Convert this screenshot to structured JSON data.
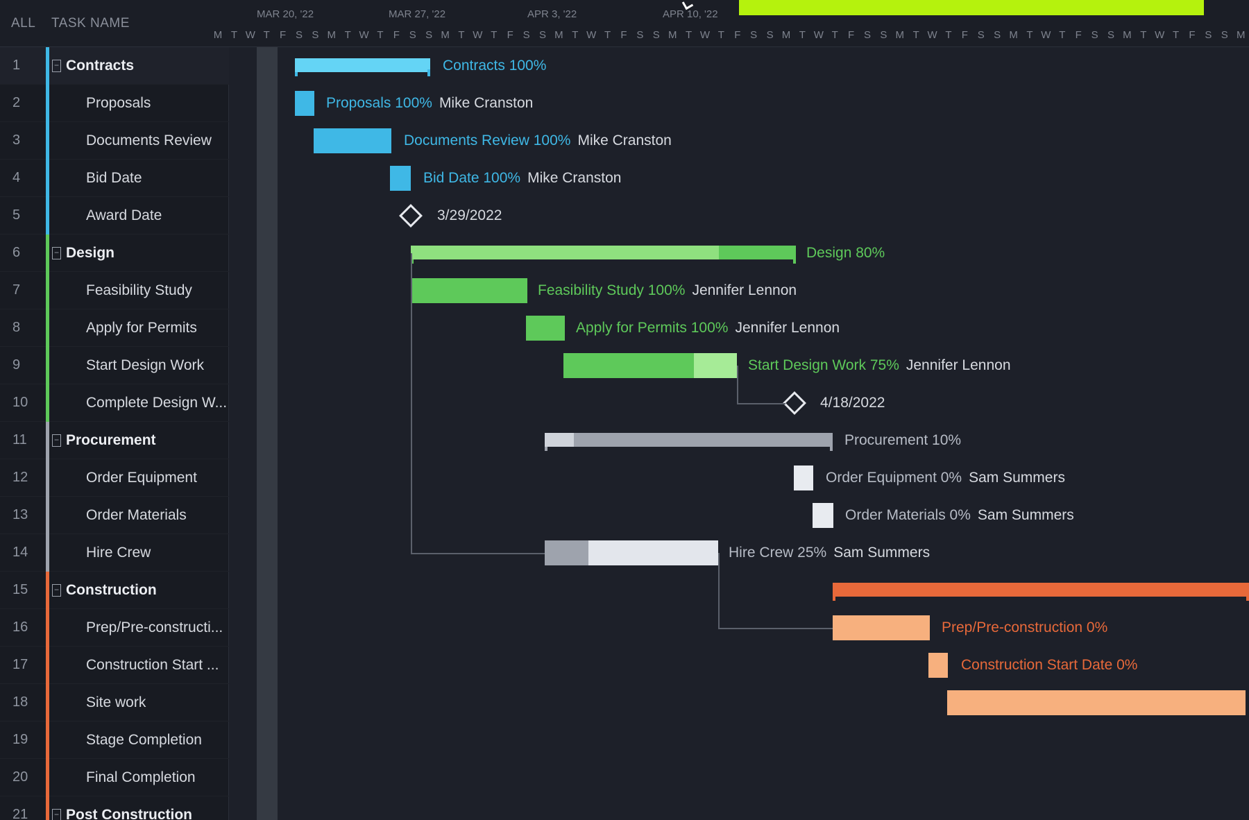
{
  "grid": {
    "header": {
      "all_label": "ALL",
      "name_label": "TASK NAME"
    },
    "rows": [
      {
        "num": "1",
        "name": "Contracts",
        "group": true,
        "color": "#3fb8e6"
      },
      {
        "num": "2",
        "name": "Proposals",
        "group": false,
        "color": "#3fb8e6"
      },
      {
        "num": "3",
        "name": "Documents Review",
        "group": false,
        "color": "#3fb8e6"
      },
      {
        "num": "4",
        "name": "Bid Date",
        "group": false,
        "color": "#3fb8e6"
      },
      {
        "num": "5",
        "name": "Award Date",
        "group": false,
        "color": "#3fb8e6"
      },
      {
        "num": "6",
        "name": "Design",
        "group": true,
        "color": "#5ec95a"
      },
      {
        "num": "7",
        "name": "Feasibility Study",
        "group": false,
        "color": "#5ec95a"
      },
      {
        "num": "8",
        "name": "Apply for Permits",
        "group": false,
        "color": "#5ec95a"
      },
      {
        "num": "9",
        "name": "Start Design Work",
        "group": false,
        "color": "#5ec95a"
      },
      {
        "num": "10",
        "name": "Complete Design W...",
        "group": false,
        "color": "#5ec95a"
      },
      {
        "num": "11",
        "name": "Procurement",
        "group": true,
        "color": "#9ea3ad"
      },
      {
        "num": "12",
        "name": "Order Equipment",
        "group": false,
        "color": "#9ea3ad"
      },
      {
        "num": "13",
        "name": "Order Materials",
        "group": false,
        "color": "#9ea3ad"
      },
      {
        "num": "14",
        "name": "Hire Crew",
        "group": false,
        "color": "#9ea3ad"
      },
      {
        "num": "15",
        "name": "Construction",
        "group": true,
        "color": "#e8693a"
      },
      {
        "num": "16",
        "name": "Prep/Pre-constructi...",
        "group": false,
        "color": "#e8693a"
      },
      {
        "num": "17",
        "name": "Construction Start ...",
        "group": false,
        "color": "#e8693a"
      },
      {
        "num": "18",
        "name": "Site work",
        "group": false,
        "color": "#e8693a"
      },
      {
        "num": "19",
        "name": "Stage Completion",
        "group": false,
        "color": "#e8693a"
      },
      {
        "num": "20",
        "name": "Final Completion",
        "group": false,
        "color": "#e8693a"
      },
      {
        "num": "21",
        "name": "Post Construction",
        "group": true,
        "color": "#e8693a"
      }
    ]
  },
  "timeline": {
    "weeks": [
      "MAR 20, '22",
      "MAR 27, '22",
      "APR 3, '22",
      "APR 10, '22"
    ],
    "day_letters": "MTWTFSSMTWTFSSMTWTFSSMTWTFSSMTWTFSSMTWTFSSMTWTFSSMTWTFSSMTWTFSSMTW",
    "tasks": [
      {
        "label": "Contracts 100%",
        "assignee": "",
        "color": "#3fb8e6"
      },
      {
        "label": "Proposals 100%",
        "assignee": "Mike Cranston",
        "color": "#3fb8e6"
      },
      {
        "label": "Documents Review 100%",
        "assignee": "Mike Cranston",
        "color": "#3fb8e6"
      },
      {
        "label": "Bid Date 100%",
        "assignee": "Mike Cranston",
        "color": "#3fb8e6"
      },
      {
        "label": "3/29/2022",
        "assignee": "",
        "color": "#d7dae0"
      },
      {
        "label": "Design 80%",
        "assignee": "",
        "color": "#5ec95a"
      },
      {
        "label": "Feasibility Study 100%",
        "assignee": "Jennifer Lennon",
        "color": "#5ec95a"
      },
      {
        "label": "Apply for Permits 100%",
        "assignee": "Jennifer Lennon",
        "color": "#5ec95a"
      },
      {
        "label": "Start Design Work 75%",
        "assignee": "Jennifer Lennon",
        "color": "#5ec95a"
      },
      {
        "label": "4/18/2022",
        "assignee": "",
        "color": "#d7dae0"
      },
      {
        "label": "Procurement 10%",
        "assignee": "",
        "color": "#b7bcc6"
      },
      {
        "label": "Order Equipment 0%",
        "assignee": "Sam Summers",
        "color": "#b7bcc6"
      },
      {
        "label": "Order Materials 0%",
        "assignee": "Sam Summers",
        "color": "#b7bcc6"
      },
      {
        "label": "Hire Crew 25%",
        "assignee": "Sam Summers",
        "color": "#b7bcc6"
      },
      {
        "label": "",
        "assignee": "",
        "color": "#e8693a"
      },
      {
        "label": "Prep/Pre-construction 0%",
        "assignee": "",
        "color": "#e8693a"
      },
      {
        "label": "Construction Start Date 0%",
        "assignee": "",
        "color": "#e8693a"
      }
    ]
  },
  "colors": {
    "contracts": "#3fb8e6",
    "design": "#5ec95a",
    "procurement": "#9ea3ad",
    "construction": "#e8693a",
    "highlight": "#b5f20d"
  }
}
